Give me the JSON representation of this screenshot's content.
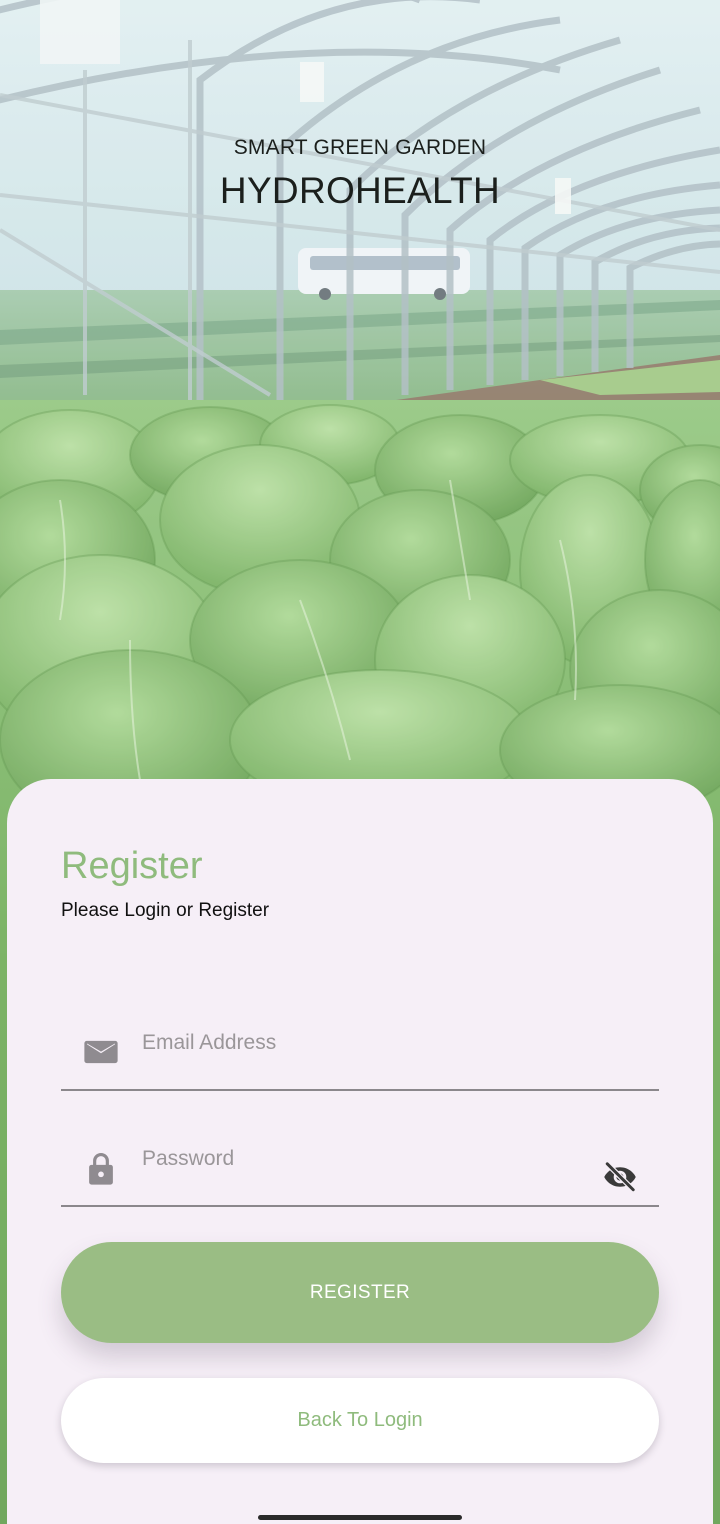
{
  "brand": {
    "subtitle": "SMART GREEN GARDEN",
    "title": "HYDROHEALTH"
  },
  "form": {
    "title": "Register",
    "subtitle": "Please Login or Register",
    "email": {
      "placeholder": "Email Address",
      "value": "",
      "icon": "mail-icon"
    },
    "password": {
      "placeholder": "Password",
      "value": "",
      "icon": "lock-icon",
      "toggle_icon": "eye-off-icon"
    },
    "register_button": "REGISTER",
    "back_button": "Back To Login"
  },
  "colors": {
    "accent_green": "#9abd84",
    "accent_text": "#8fbb7d",
    "card_background": "#f6eff7"
  }
}
